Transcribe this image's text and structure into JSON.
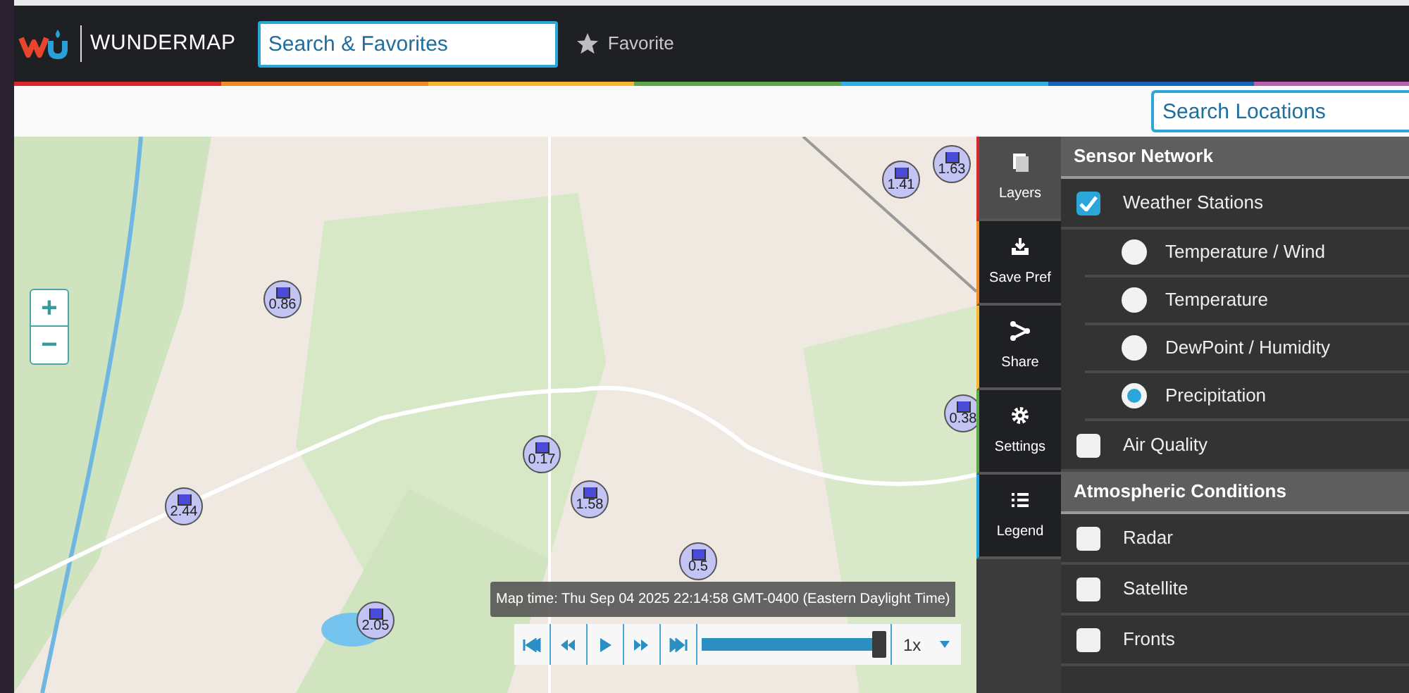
{
  "header": {
    "brand": "WUNDERMAP",
    "search_placeholder": "Search & Favorites",
    "favorite_label": "Favorite"
  },
  "location_search": {
    "placeholder": "Search Locations"
  },
  "map": {
    "zoom_in": "+",
    "zoom_out": "−",
    "markers": [
      {
        "value": "1.41"
      },
      {
        "value": "1.63"
      },
      {
        "value": "0.86"
      },
      {
        "value": "0.38"
      },
      {
        "value": "0.17"
      },
      {
        "value": "1.58"
      },
      {
        "value": "2.44"
      },
      {
        "value": "0.5"
      },
      {
        "value": "2.05"
      }
    ],
    "map_time": "Map time: Thu Sep 04 2025 22:14:58 GMT-0400 (Eastern Daylight Time)",
    "playback": {
      "level": 1,
      "speed": "1x"
    }
  },
  "side_tabs": [
    {
      "label": "Layers",
      "selected": true,
      "color": "#d9262c"
    },
    {
      "label": "Save Pref",
      "selected": false,
      "color": "#f08a24"
    },
    {
      "label": "Share",
      "selected": false,
      "color": "#f5b82e"
    },
    {
      "label": "Settings",
      "selected": false,
      "color": "#5fa84a"
    },
    {
      "label": "Legend",
      "selected": false,
      "color": "#1fa6dd"
    }
  ],
  "sections": [
    {
      "title": "Sensor Network",
      "items": [
        {
          "kind": "checkbox",
          "label": "Weather Stations",
          "checked": true
        },
        {
          "kind": "radio",
          "label": "Temperature / Wind",
          "selected": false
        },
        {
          "kind": "radio",
          "label": "Temperature",
          "selected": false
        },
        {
          "kind": "radio",
          "label": "DewPoint / Humidity",
          "selected": false
        },
        {
          "kind": "radio",
          "label": "Precipitation",
          "selected": true
        },
        {
          "kind": "checkbox",
          "label": "Air Quality",
          "checked": false
        }
      ]
    },
    {
      "title": "Atmospheric Conditions",
      "items": [
        {
          "kind": "checkbox",
          "label": "Radar",
          "checked": false
        },
        {
          "kind": "checkbox",
          "label": "Satellite",
          "checked": false
        },
        {
          "kind": "checkbox",
          "label": "Fronts",
          "checked": false
        }
      ]
    }
  ]
}
